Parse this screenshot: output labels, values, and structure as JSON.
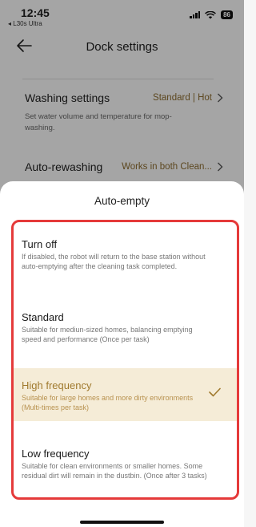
{
  "status_bar": {
    "time": "12:45",
    "back_app": "◂ L30s Ultra",
    "battery": "86"
  },
  "nav": {
    "title": "Dock settings"
  },
  "settings": {
    "washing": {
      "title": "Washing settings",
      "value": "Standard | Hot",
      "description": "Set water volume and temperature for mop-washing."
    },
    "rewashing": {
      "title": "Auto-rewashing",
      "value": "Works in both Clean..."
    }
  },
  "sheet": {
    "title": "Auto-empty",
    "selected": "high_frequency",
    "options": {
      "turn_off": {
        "label": "Turn off",
        "description": "If disabled, the robot will return to the base station without auto-emptying after the cleaning task completed."
      },
      "standard": {
        "label": "Standard",
        "description": "Suitable for mediun-sized homes, balancing emptying speed and performance (Once per task)"
      },
      "high_frequency": {
        "label": "High frequency",
        "description": "Suitable for large homes and more dirty environments (Multi-times per task)"
      },
      "low_frequency": {
        "label": "Low frequency",
        "description": "Suitable for clean environments or smaller homes. Some residual dirt will remain in the dustbin. (Once after 3 tasks)"
      }
    }
  },
  "colors": {
    "accent": "#a07a2e",
    "selected_bg": "#f5ecd7",
    "highlight_border": "#e53a3a"
  },
  "icons": [
    "back-arrow-icon",
    "chevron-right-icon",
    "checkmark-icon",
    "signal-icon",
    "wifi-icon",
    "battery-icon"
  ]
}
